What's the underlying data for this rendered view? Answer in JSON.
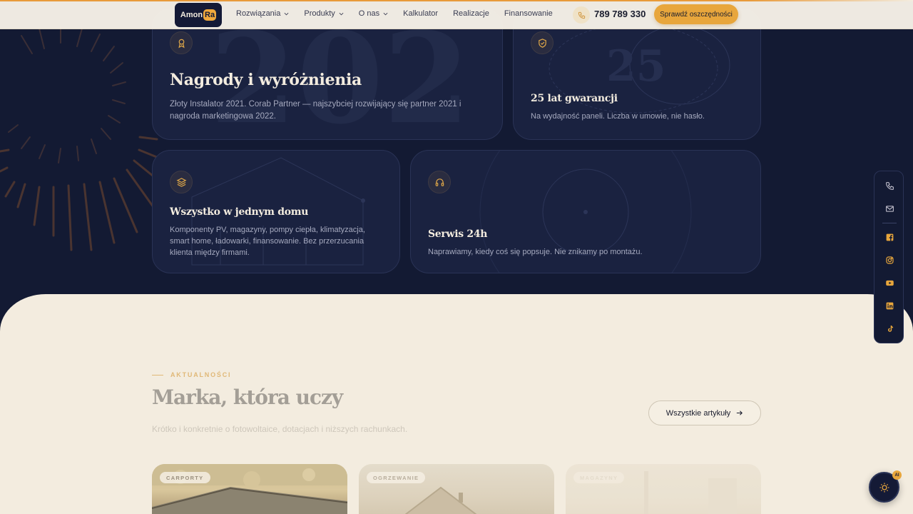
{
  "colors": {
    "navy": "#131a33",
    "card": "#1a2240",
    "accent": "#e8a63c",
    "cream": "#f3ecdf"
  },
  "header": {
    "logo": {
      "part1": "Amon",
      "part2": "Ra"
    },
    "nav": [
      {
        "label": "Rozwiązania",
        "dropdown": true
      },
      {
        "label": "Produkty",
        "dropdown": true
      },
      {
        "label": "O nas",
        "dropdown": true
      },
      {
        "label": "Kalkulator",
        "dropdown": false
      },
      {
        "label": "Realizacje",
        "dropdown": false
      },
      {
        "label": "Finansowanie",
        "dropdown": false
      }
    ],
    "phone": "789 789 330",
    "cta": "Sprawdź oszczędności"
  },
  "features": {
    "awards": {
      "icon": "award-icon",
      "bg_number": "202",
      "title": "Nagrody i wyróżnienia",
      "text": "Złoty Instalator 2021. Corab Partner — najszybciej rozwijający się partner 2021 i nagroda marketingowa 2022."
    },
    "warranty": {
      "icon": "shield-check-icon",
      "bg_number": "25",
      "title": "25 lat gwarancji",
      "text": "Na wydajność paneli. Liczba w umowie, nie hasło."
    },
    "home": {
      "icon": "layers-icon",
      "title": "Wszystko w jednym domu",
      "text": "Komponenty PV, magazyny, pompy ciepła, klimatyzacja, smart home, ładowarki, finansowanie. Bez przerzucania klienta między firmami."
    },
    "service": {
      "icon": "headset-icon",
      "title": "Serwis 24h",
      "text": "Naprawiamy, kiedy coś się popsuje. Nie znikamy po montażu."
    }
  },
  "news": {
    "eyebrow": "AKTUALNOŚCI",
    "title": "Marka, która uczy",
    "subtitle": "Krótko i konkretnie o fotowoltaice, dotacjach i niższych rachunkach.",
    "all_button": "Wszystkie artykuły",
    "articles": [
      {
        "tag": "CARPORTY"
      },
      {
        "tag": "OGRZEWANIE"
      },
      {
        "tag": "MAGAZYNY"
      }
    ]
  },
  "social": [
    "phone-icon",
    "mail-icon",
    "facebook-icon",
    "instagram-icon",
    "youtube-icon",
    "linkedin-icon",
    "tiktok-icon"
  ],
  "fab": {
    "badge": "AI",
    "icon": "sun-icon"
  }
}
